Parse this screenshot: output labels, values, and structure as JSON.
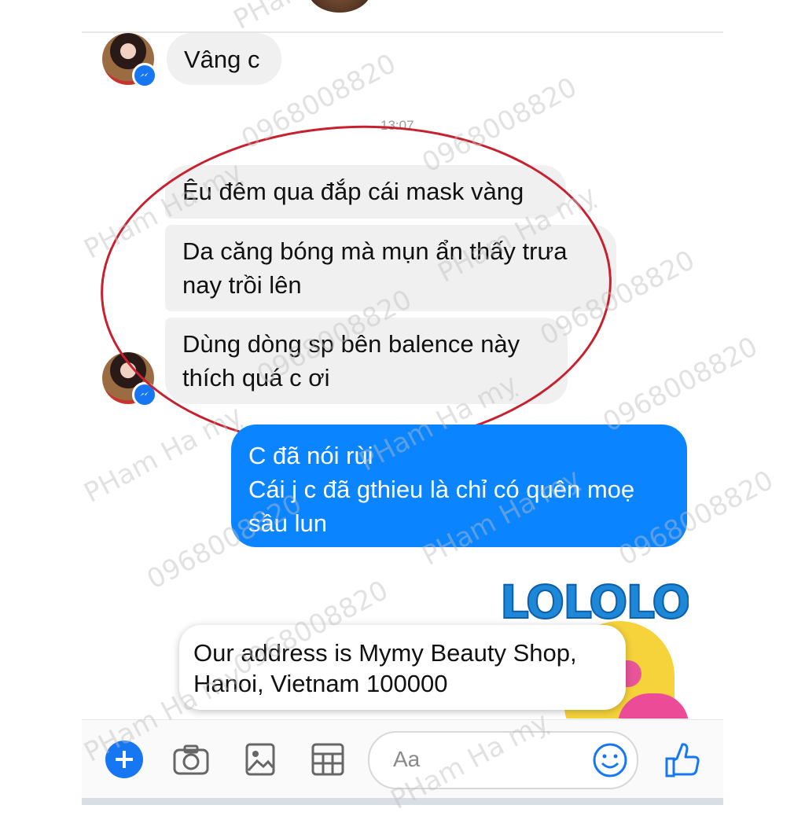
{
  "conversation": {
    "incoming_top": "Vâng c",
    "timestamp": "13:07",
    "incoming": [
      "Êu đêm qua đắp cái mask vàng",
      "Da căng bóng mà mụn ẩn thấy trưa\nnay trồi lên",
      "Dùng dòng sp bên balence này\nthích quá c ơi"
    ],
    "outgoing": "C đã nói rùi\nCái j c đã gthieu là chỉ có quên moẹ\nsầu lun"
  },
  "sticker": {
    "text": "LOLOLOL"
  },
  "popup": {
    "text": "Our address is Mymy Beauty Shop,\nHanoi, Vietnam 100000"
  },
  "composer": {
    "placeholder": "Aa"
  },
  "watermark": {
    "phone": "0968008820",
    "name": "PHam Ha mỵ"
  },
  "colors": {
    "messenger_blue": "#0a84ff",
    "annotation_red": "#c8202e",
    "bubble_gray": "#f1f0f0"
  }
}
